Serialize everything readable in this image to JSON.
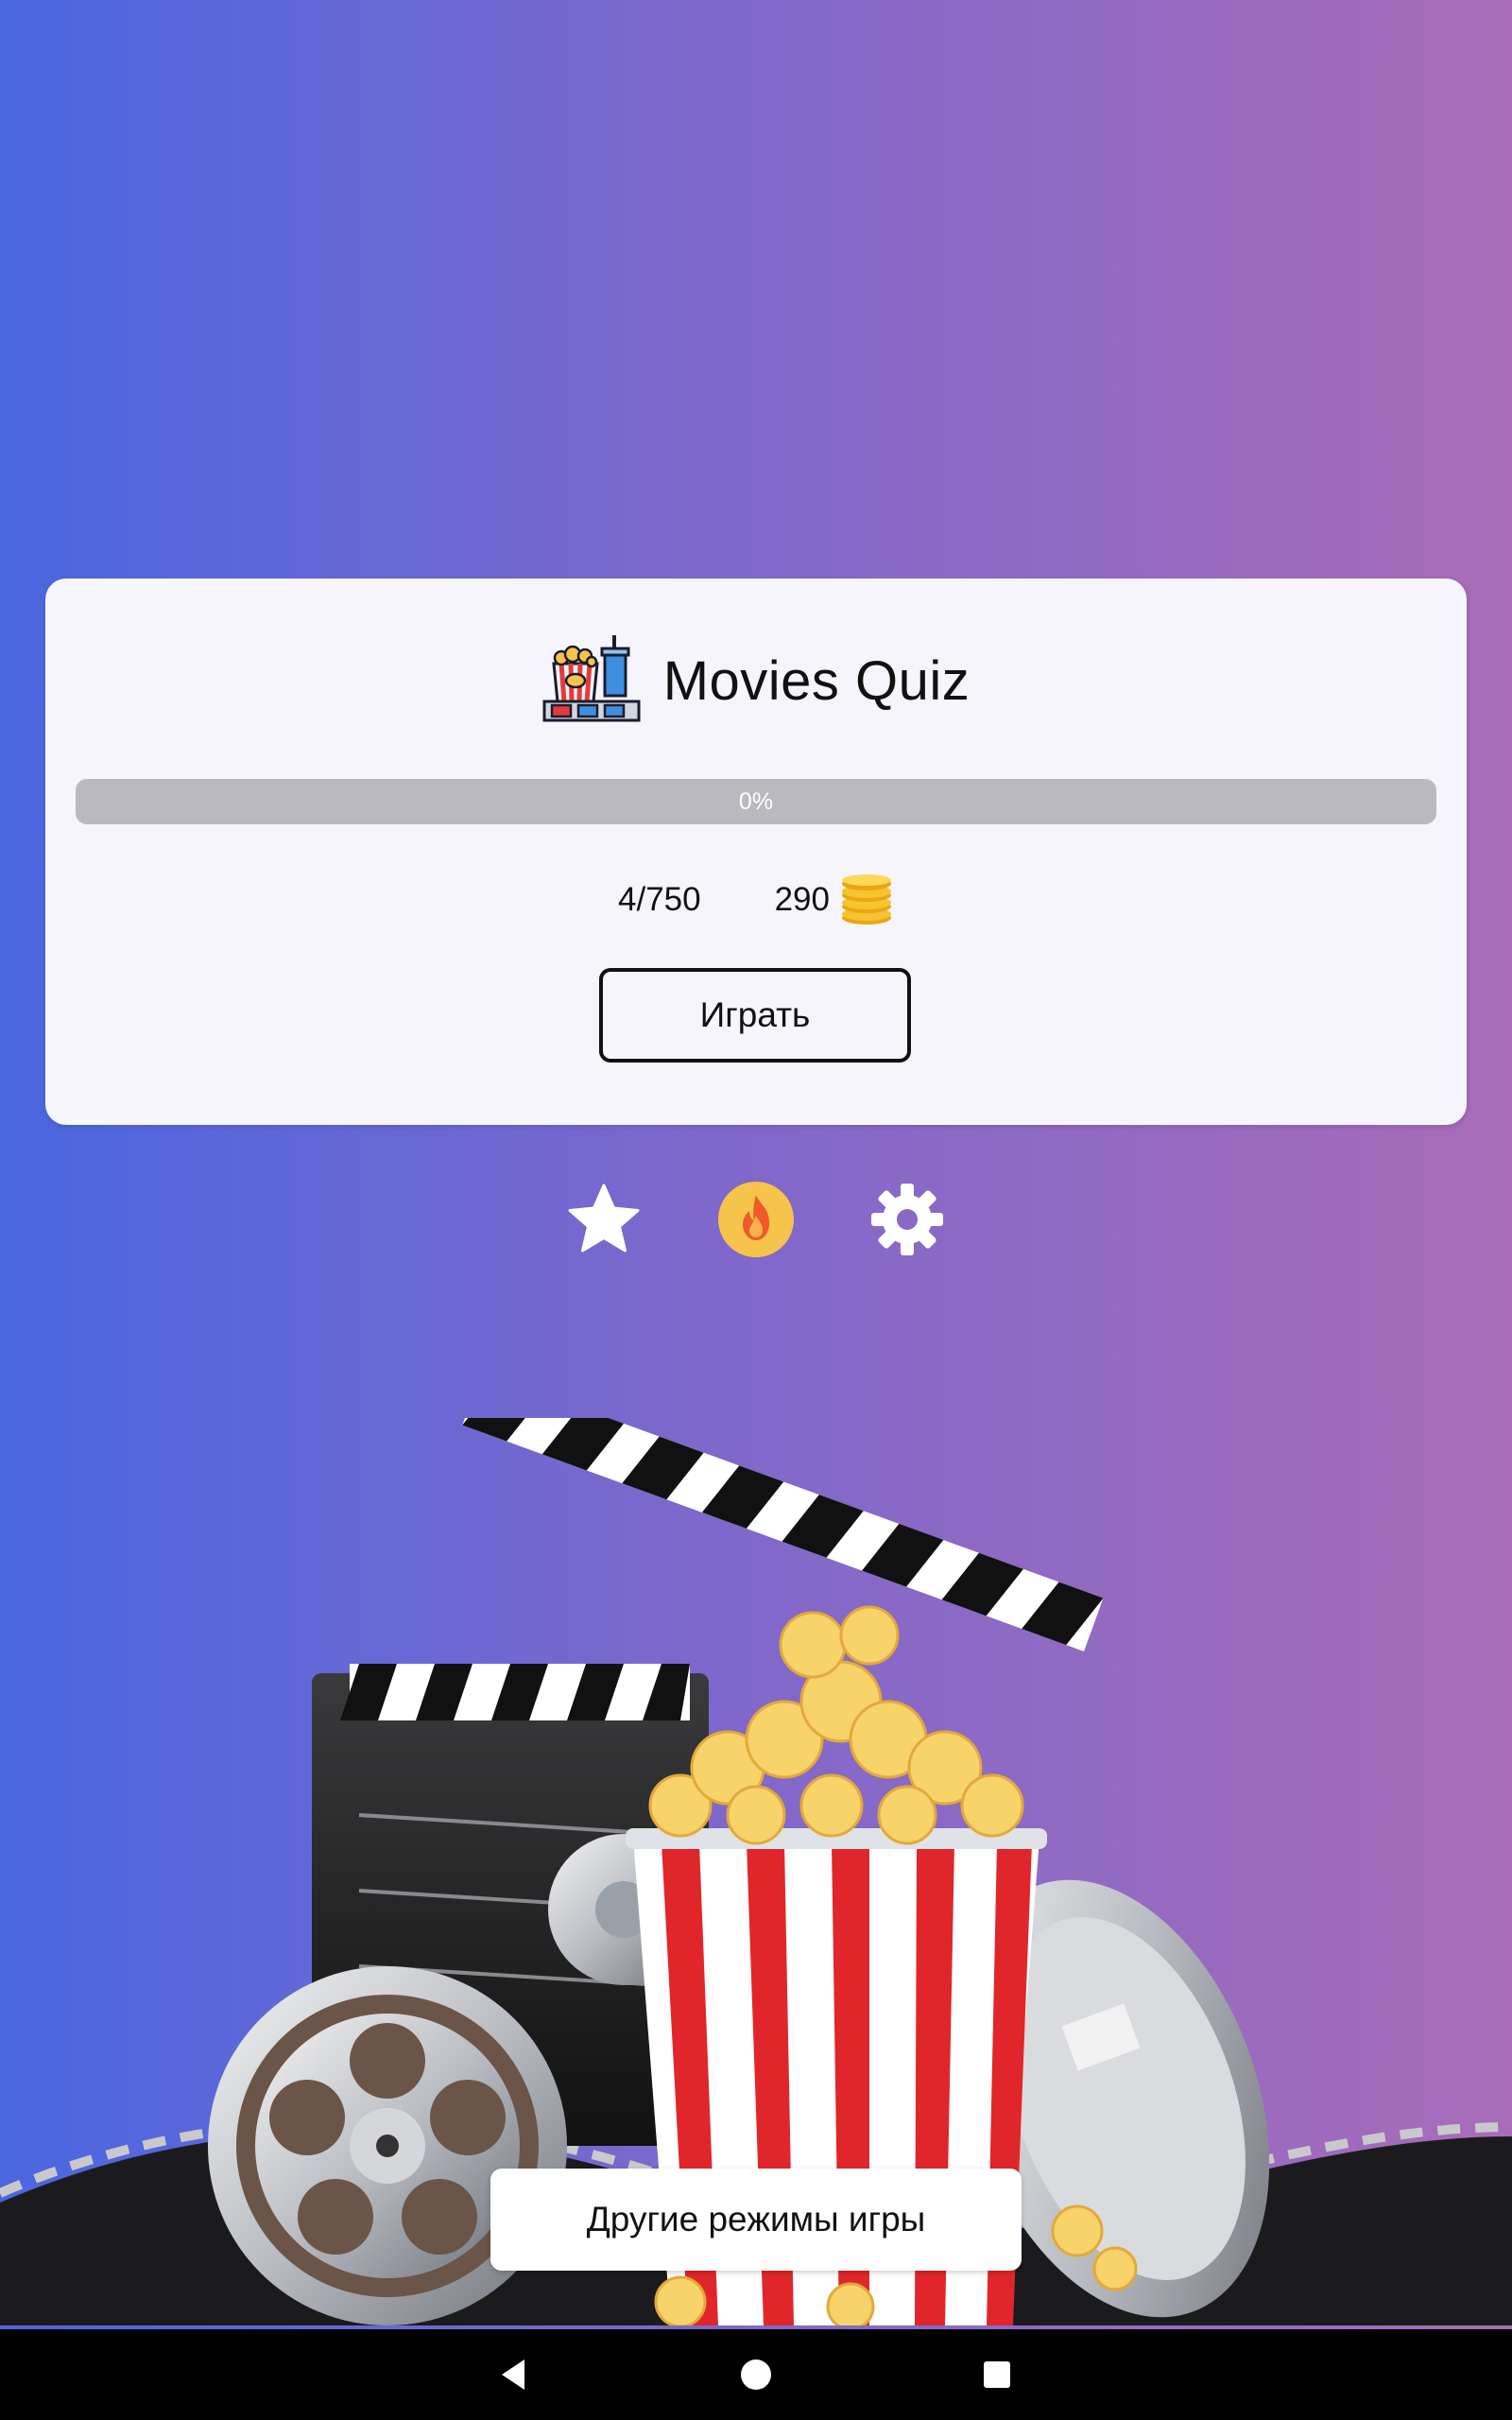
{
  "app": {
    "title": "Movies Quiz",
    "title_icon": "popcorn-cinema-icon"
  },
  "progress": {
    "label": "0%",
    "value": 0
  },
  "stats": {
    "solved": "4/750",
    "coins": "290",
    "coin_icon": "coins-stack-icon"
  },
  "buttons": {
    "play_label": "Играть",
    "other_modes_label": "Другие режимы игры"
  },
  "actions": [
    {
      "icon": "star-icon"
    },
    {
      "icon": "fire-icon"
    },
    {
      "icon": "gear-icon"
    }
  ],
  "navbar": {
    "back_icon": "back-triangle-icon",
    "home_icon": "home-circle-icon",
    "recents_icon": "recents-square-icon"
  },
  "colors": {
    "gradient_left": "#4a67e0",
    "gradient_right": "#a86cb8",
    "card_background": "#f6f5fb",
    "progress_track": "#b9b9bf",
    "fire_badge": "#f6c34b"
  }
}
